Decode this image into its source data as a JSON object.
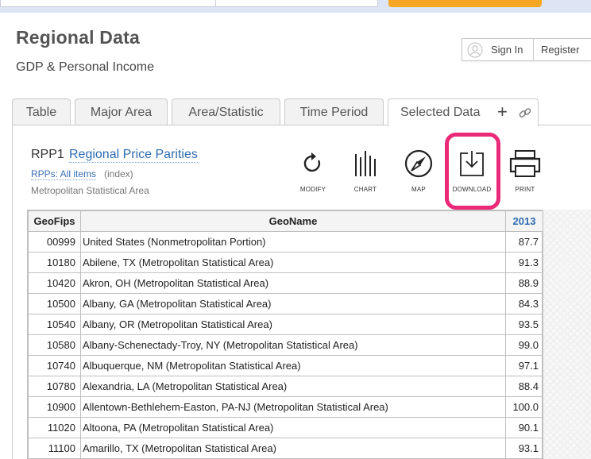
{
  "header": {
    "title": "Regional Data",
    "subtitle": "GDP & Personal Income",
    "sign_in": "Sign In",
    "register": "Register"
  },
  "tabs": [
    {
      "label": "Table"
    },
    {
      "label": "Major Area"
    },
    {
      "label": "Area/Statistic"
    },
    {
      "label": "Time Period"
    },
    {
      "label": "Selected Data"
    }
  ],
  "dataset": {
    "code": "RPP1",
    "name": "Regional Price Parities",
    "statistic": "RPPs: All items",
    "unit": "(index)",
    "area": "Metropolitan Statistical Area"
  },
  "toolbar": {
    "modify": "MODIFY",
    "chart": "CHART",
    "map": "MAP",
    "download": "DOWNLOAD",
    "print": "PRINT"
  },
  "table": {
    "columns": [
      "GeoFips",
      "GeoName",
      "2013"
    ],
    "rows": [
      [
        "00999",
        "United States (Nonmetropolitan Portion)",
        "87.7"
      ],
      [
        "10180",
        "Abilene, TX (Metropolitan Statistical Area)",
        "91.3"
      ],
      [
        "10420",
        "Akron, OH (Metropolitan Statistical Area)",
        "88.9"
      ],
      [
        "10500",
        "Albany, GA (Metropolitan Statistical Area)",
        "84.3"
      ],
      [
        "10540",
        "Albany, OR (Metropolitan Statistical Area)",
        "93.5"
      ],
      [
        "10580",
        "Albany-Schenectady-Troy, NY (Metropolitan Statistical Area)",
        "99.0"
      ],
      [
        "10740",
        "Albuquerque, NM (Metropolitan Statistical Area)",
        "97.1"
      ],
      [
        "10780",
        "Alexandria, LA (Metropolitan Statistical Area)",
        "88.4"
      ],
      [
        "10900",
        "Allentown-Bethlehem-Easton, PA-NJ (Metropolitan Statistical Area)",
        "100.0"
      ],
      [
        "11020",
        "Altoona, PA (Metropolitan Statistical Area)",
        "90.1"
      ],
      [
        "11100",
        "Amarillo, TX (Metropolitan Statistical Area)",
        "93.1"
      ]
    ]
  },
  "colors": {
    "accent_blue": "#2d6bb1",
    "highlight_ring": "#ea2a79",
    "top_button": "#f6a623"
  }
}
